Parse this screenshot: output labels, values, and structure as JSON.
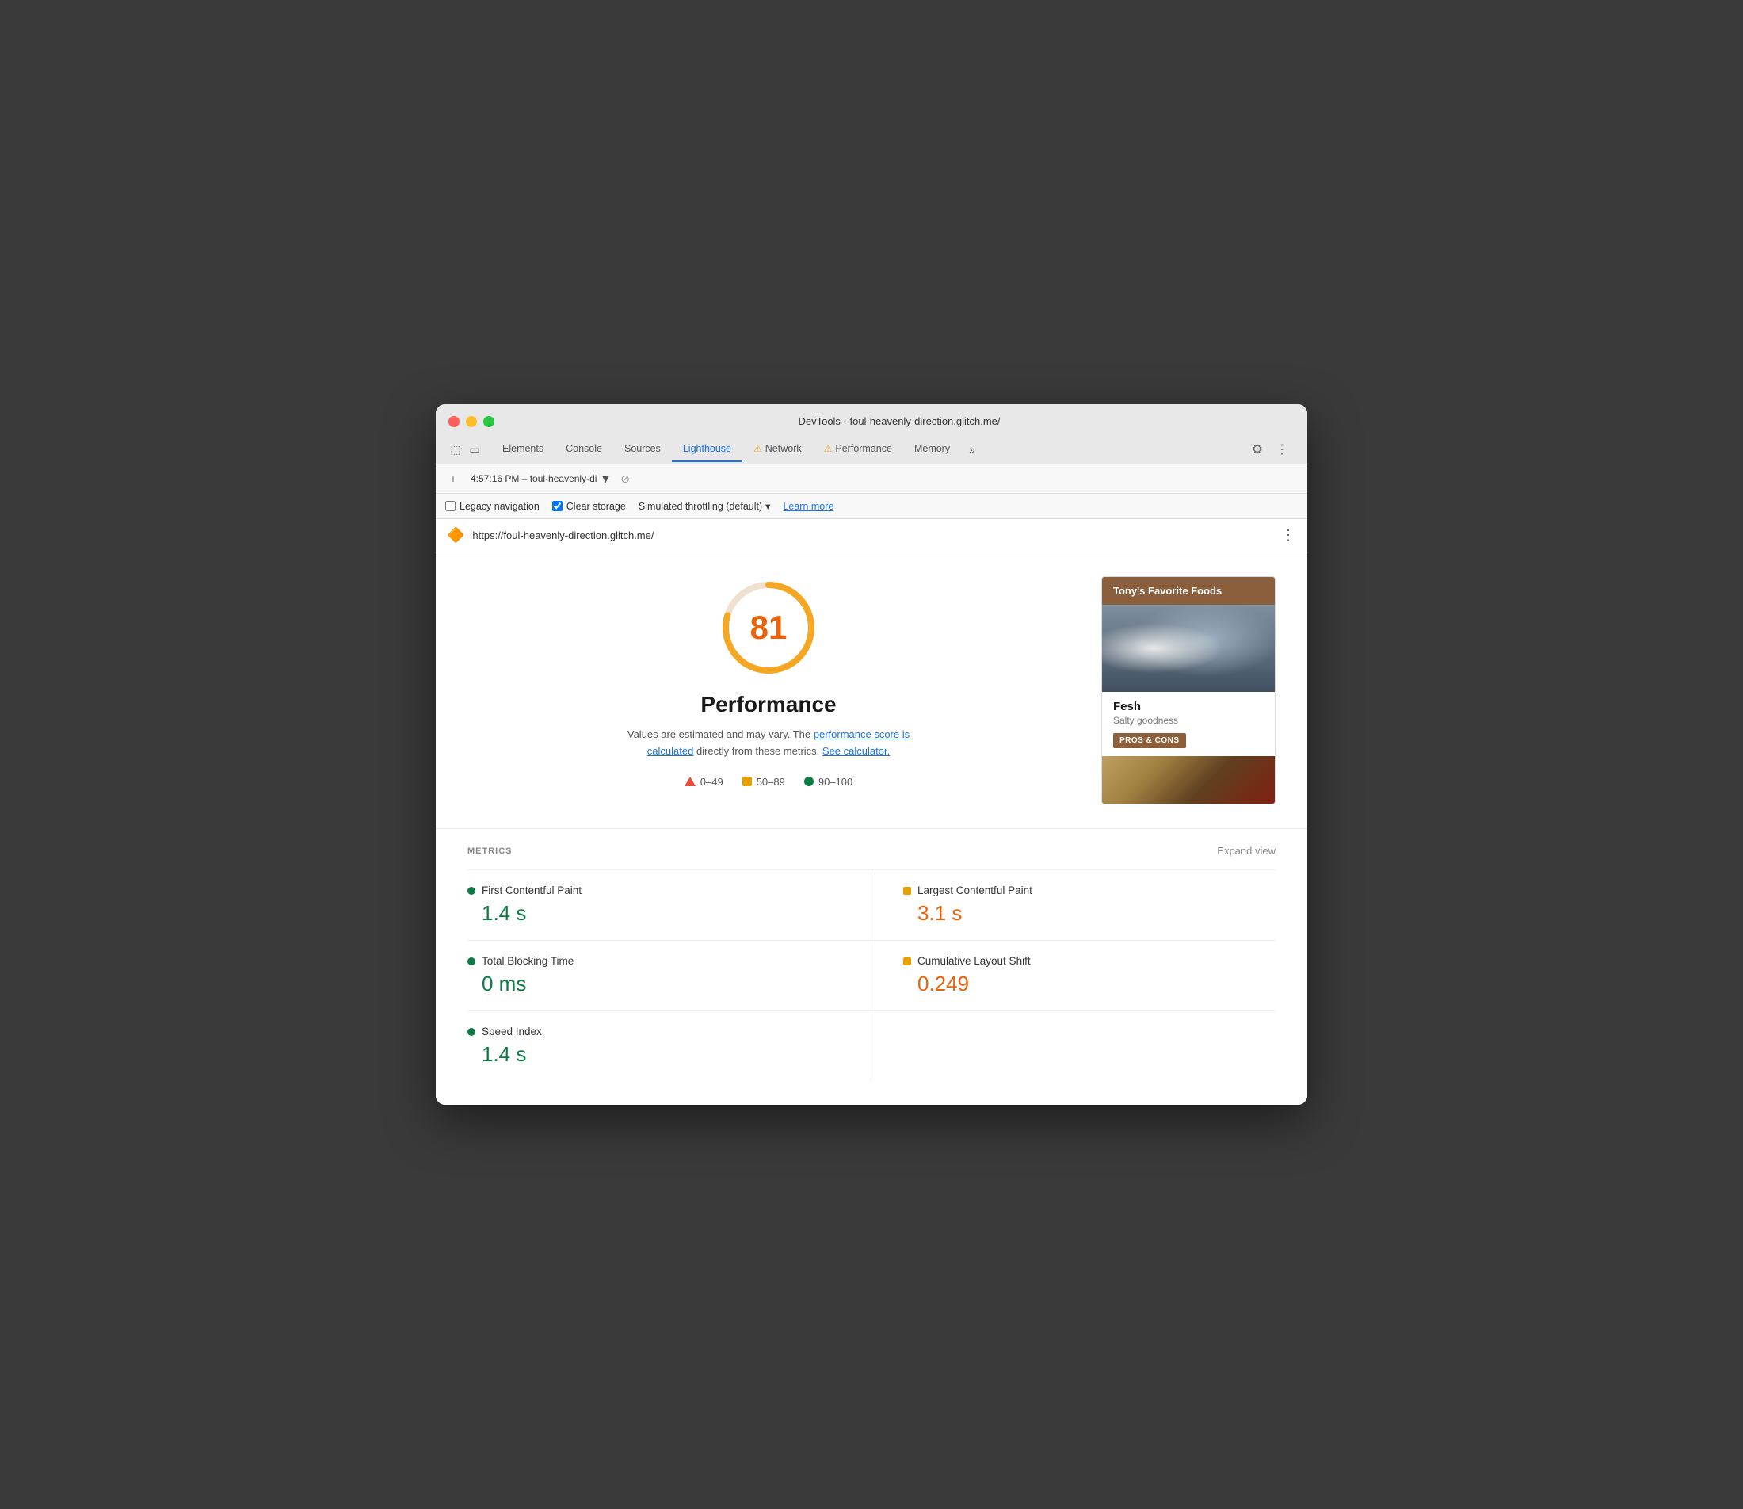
{
  "window": {
    "title": "DevTools - foul-heavenly-direction.glitch.me/",
    "tabs": [
      {
        "label": "Elements",
        "active": false,
        "warning": false
      },
      {
        "label": "Console",
        "active": false,
        "warning": false
      },
      {
        "label": "Sources",
        "active": false,
        "warning": false
      },
      {
        "label": "Lighthouse",
        "active": true,
        "warning": false
      },
      {
        "label": "Network",
        "active": false,
        "warning": true
      },
      {
        "label": "Performance",
        "active": false,
        "warning": true
      },
      {
        "label": "Memory",
        "active": false,
        "warning": false
      }
    ]
  },
  "toolbar": {
    "timestamp": "4:57:16 PM – foul-heavenly-di",
    "add_icon": "+",
    "dropdown_symbol": "▼"
  },
  "options": {
    "legacy_navigation_label": "Legacy navigation",
    "legacy_navigation_checked": false,
    "clear_storage_label": "Clear storage",
    "clear_storage_checked": true,
    "throttling_label": "Simulated throttling (default)",
    "dropdown_symbol": "▾",
    "learn_more_label": "Learn more"
  },
  "url_bar": {
    "url": "https://foul-heavenly-direction.glitch.me/"
  },
  "score": {
    "value": "81",
    "label": "Performance",
    "description": "Values are estimated and may vary. The",
    "link1": "performance score is calculated",
    "link1_mid": " directly from these metrics. ",
    "link2": "See calculator.",
    "legend": [
      {
        "range": "0–49",
        "type": "triangle"
      },
      {
        "range": "50–89",
        "type": "square"
      },
      {
        "range": "90–100",
        "type": "circle"
      }
    ]
  },
  "preview_card": {
    "header": "Tony's Favorite Foods",
    "item_title": "Fesh",
    "item_subtitle": "Salty goodness",
    "button_label": "PROS & CONS"
  },
  "metrics": {
    "section_label": "METRICS",
    "expand_label": "Expand view",
    "items": [
      {
        "name": "First Contentful Paint",
        "value": "1.4 s",
        "status": "green"
      },
      {
        "name": "Largest Contentful Paint",
        "value": "3.1 s",
        "status": "orange"
      },
      {
        "name": "Total Blocking Time",
        "value": "0 ms",
        "status": "green"
      },
      {
        "name": "Cumulative Layout Shift",
        "value": "0.249",
        "status": "orange"
      },
      {
        "name": "Speed Index",
        "value": "1.4 s",
        "status": "green"
      }
    ]
  }
}
